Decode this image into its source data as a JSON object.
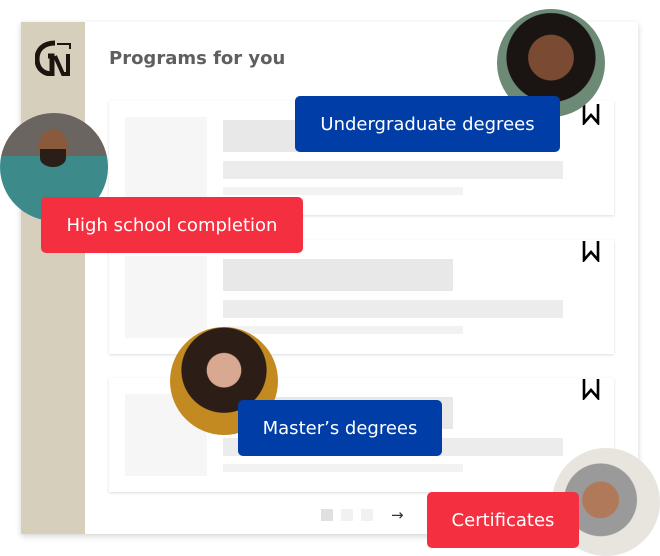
{
  "header": {
    "title": "Programs for you",
    "logo": "G"
  },
  "cards": [
    {
      "bookmark_icon": "bookmark-icon"
    },
    {
      "bookmark_icon": "bookmark-icon"
    },
    {
      "bookmark_icon": "bookmark-icon"
    }
  ],
  "pagination": {
    "pages": 3,
    "current": 1,
    "next_icon": "→"
  },
  "tags": {
    "undergraduate": "Undergraduate degrees",
    "high_school": "High school completion",
    "masters": "Master’s degrees",
    "certificates": "Certificates"
  },
  "colors": {
    "blue": "#003da6",
    "red": "#f43040",
    "sidebar": "#d6cfbc"
  }
}
